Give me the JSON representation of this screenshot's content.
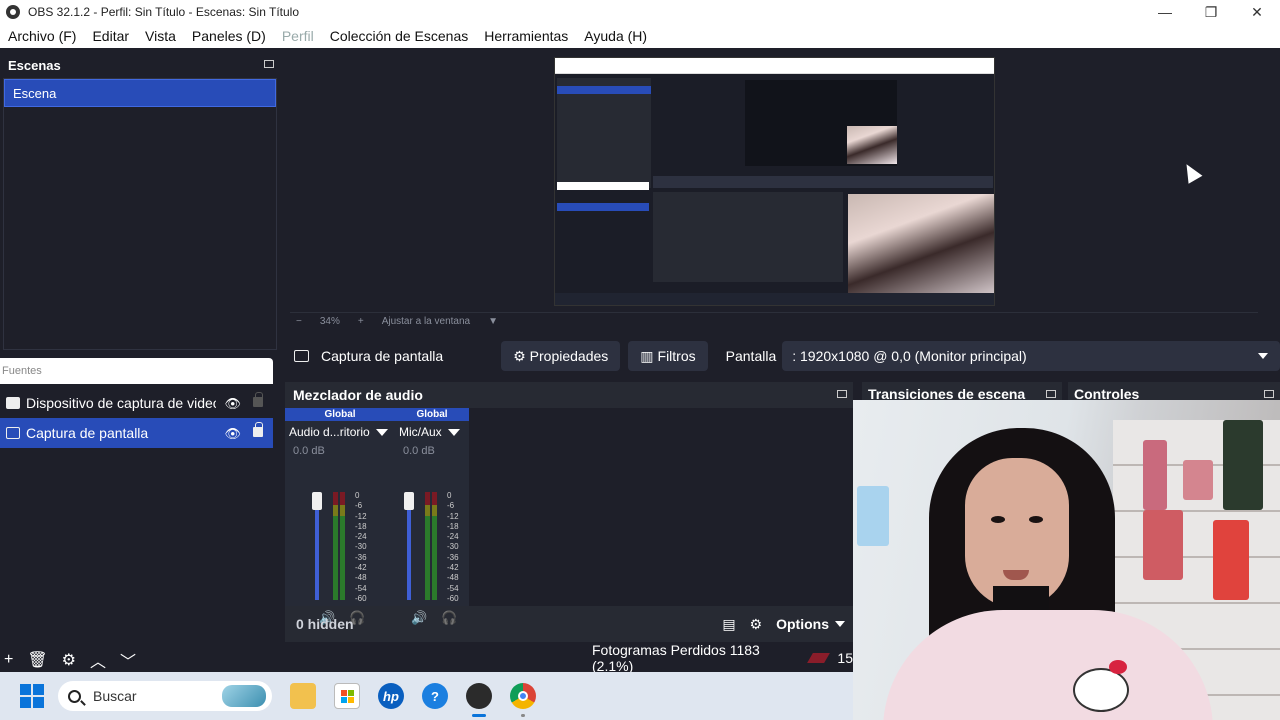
{
  "window": {
    "title": "OBS 32.1.2 - Perfil: Sin Título - Escenas: Sin Título"
  },
  "menu": [
    "Archivo (F)",
    "Editar",
    "Vista",
    "Paneles (D)",
    "Perfil",
    "Colección de Escenas",
    "Herramientas",
    "Ayuda (H)"
  ],
  "scenes": {
    "title": "Escenas",
    "items": [
      "Escena"
    ]
  },
  "sources": {
    "title": "Fuentes",
    "items": [
      {
        "label": "Dispositivo de captura de video"
      },
      {
        "label": "Captura de pantalla"
      }
    ]
  },
  "preview": {
    "zoom": "34%",
    "fit_label": "Ajustar a la ventana"
  },
  "context_bar": {
    "source_name": "Captura de pantalla",
    "properties_label": "Propiedades",
    "filters_label": "Filtros",
    "display_label": "Pantalla",
    "display_value": ": 1920x1080 @ 0,0 (Monitor principal)"
  },
  "mixer": {
    "title": "Mezclador de audio",
    "channels": [
      {
        "tag": "Global",
        "name": "Audio d...ritorio",
        "db": "0.0 dB"
      },
      {
        "tag": "Global",
        "name": "Mic/Aux",
        "db": "0.0 dB"
      }
    ],
    "scale": [
      "0",
      "-6",
      "-12",
      "-18",
      "-24",
      "-30",
      "-36",
      "-42",
      "-48",
      "-54",
      "-60"
    ],
    "hidden_label": "0 hidden",
    "options_label": "Options"
  },
  "transitions": {
    "title": "Transiciones de escena"
  },
  "controls": {
    "title": "Controles"
  },
  "status": {
    "dropped_frames": "Fotogramas Perdidos 1183 (2.1%)",
    "fps": "15"
  },
  "taskbar": {
    "search_placeholder": "Buscar"
  },
  "colors": {
    "accent": "#284cb8",
    "panel": "#272a33",
    "background": "#1e1f29"
  }
}
